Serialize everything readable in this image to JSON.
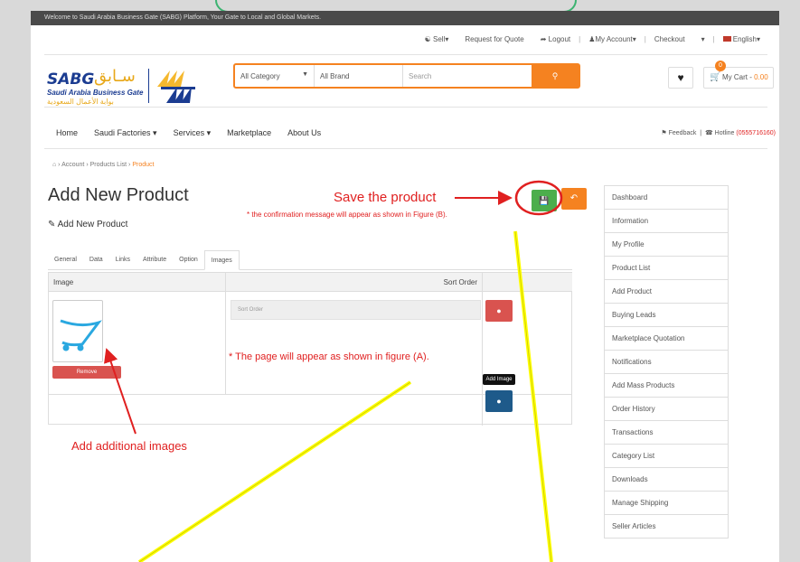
{
  "welcome_bar": "Welcome to Saudi Arabia Business Gate (SABG) Platform, Your Gate to Local and Global Markets.",
  "top_links": {
    "sell": "Sell",
    "request_quote": "Request for Quote",
    "logout": "Logout",
    "my_account": "My Account",
    "checkout": "Checkout",
    "language": "English"
  },
  "logo": {
    "abbr": "SABG",
    "arabic_abbr": "سـابق",
    "name_en": "Saudi Arabia Business Gate",
    "name_ar": "بوابة الأعمال السعودية"
  },
  "search": {
    "category": "All Category",
    "brand": "All Brand",
    "placeholder": "Search"
  },
  "cart": {
    "count": "0",
    "label": "My Cart - ",
    "amount": "0.00"
  },
  "main_nav": [
    "Home",
    "Saudi Factories",
    "Services",
    "Marketplace",
    "About Us"
  ],
  "feedback": {
    "feedback": "Feedback",
    "hotline_label": "Hotline",
    "hotline_number": "(0555716160)"
  },
  "breadcrumb": {
    "account": "Account",
    "products_list": "Products List",
    "current": "Product"
  },
  "page": {
    "title": "Add New Product",
    "subtitle": "Add New Product"
  },
  "tabs": [
    "General",
    "Data",
    "Links",
    "Attribute",
    "Option",
    "Images"
  ],
  "table": {
    "col_image": "Image",
    "col_sort": "Sort Order",
    "sort_placeholder": "Sort Order",
    "remove_label": "Remove",
    "add_image_tooltip": "Add Image"
  },
  "sidebar": [
    "Dashboard",
    "Information",
    "My Profile",
    "Product List",
    "Add Product",
    "Buying Leads",
    "Marketplace Quotation",
    "Notifications",
    "Add Mass Products",
    "Order History",
    "Transactions",
    "Category List",
    "Downloads",
    "Manage Shipping",
    "Seller Articles"
  ],
  "annotations": {
    "save": "Save the product",
    "save_note": "* the confirmation message will appear as shown in Figure (B).",
    "page_note": "* The page will appear as shown in figure (A).",
    "add_images": "Add additional images"
  },
  "colors": {
    "orange": "#f58220",
    "green": "#4cae4c",
    "red": "#d9534f",
    "blue": "#1e5a8a",
    "annotation_red": "#e02020",
    "yellow_line": "#ffff00"
  }
}
